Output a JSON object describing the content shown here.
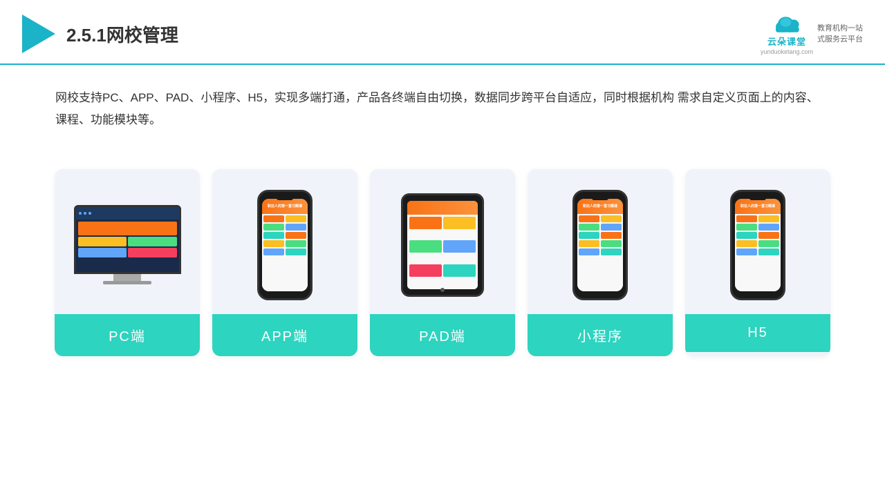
{
  "header": {
    "title": "2.5.1网校管理",
    "brand": {
      "name": "云朵课堂",
      "url": "yunduoketang.com",
      "tagline": "教育机构一站\n式服务云平台"
    }
  },
  "description": "网校支持PC、APP、PAD、小程序、H5，实现多端打通，产品各终端自由切换，数据同步跨平台自适应，同时根据机构\n需求自定义页面上的内容、课程、功能模块等。",
  "cards": [
    {
      "id": "pc",
      "label": "PC端",
      "device": "pc"
    },
    {
      "id": "app",
      "label": "APP端",
      "device": "phone"
    },
    {
      "id": "pad",
      "label": "PAD端",
      "device": "tablet"
    },
    {
      "id": "miniapp",
      "label": "小程序",
      "device": "phone"
    },
    {
      "id": "h5",
      "label": "H5",
      "device": "phone"
    }
  ],
  "colors": {
    "teal": "#2dd4bf",
    "accent": "#1ab3c8",
    "border": "#1ab3c8"
  }
}
